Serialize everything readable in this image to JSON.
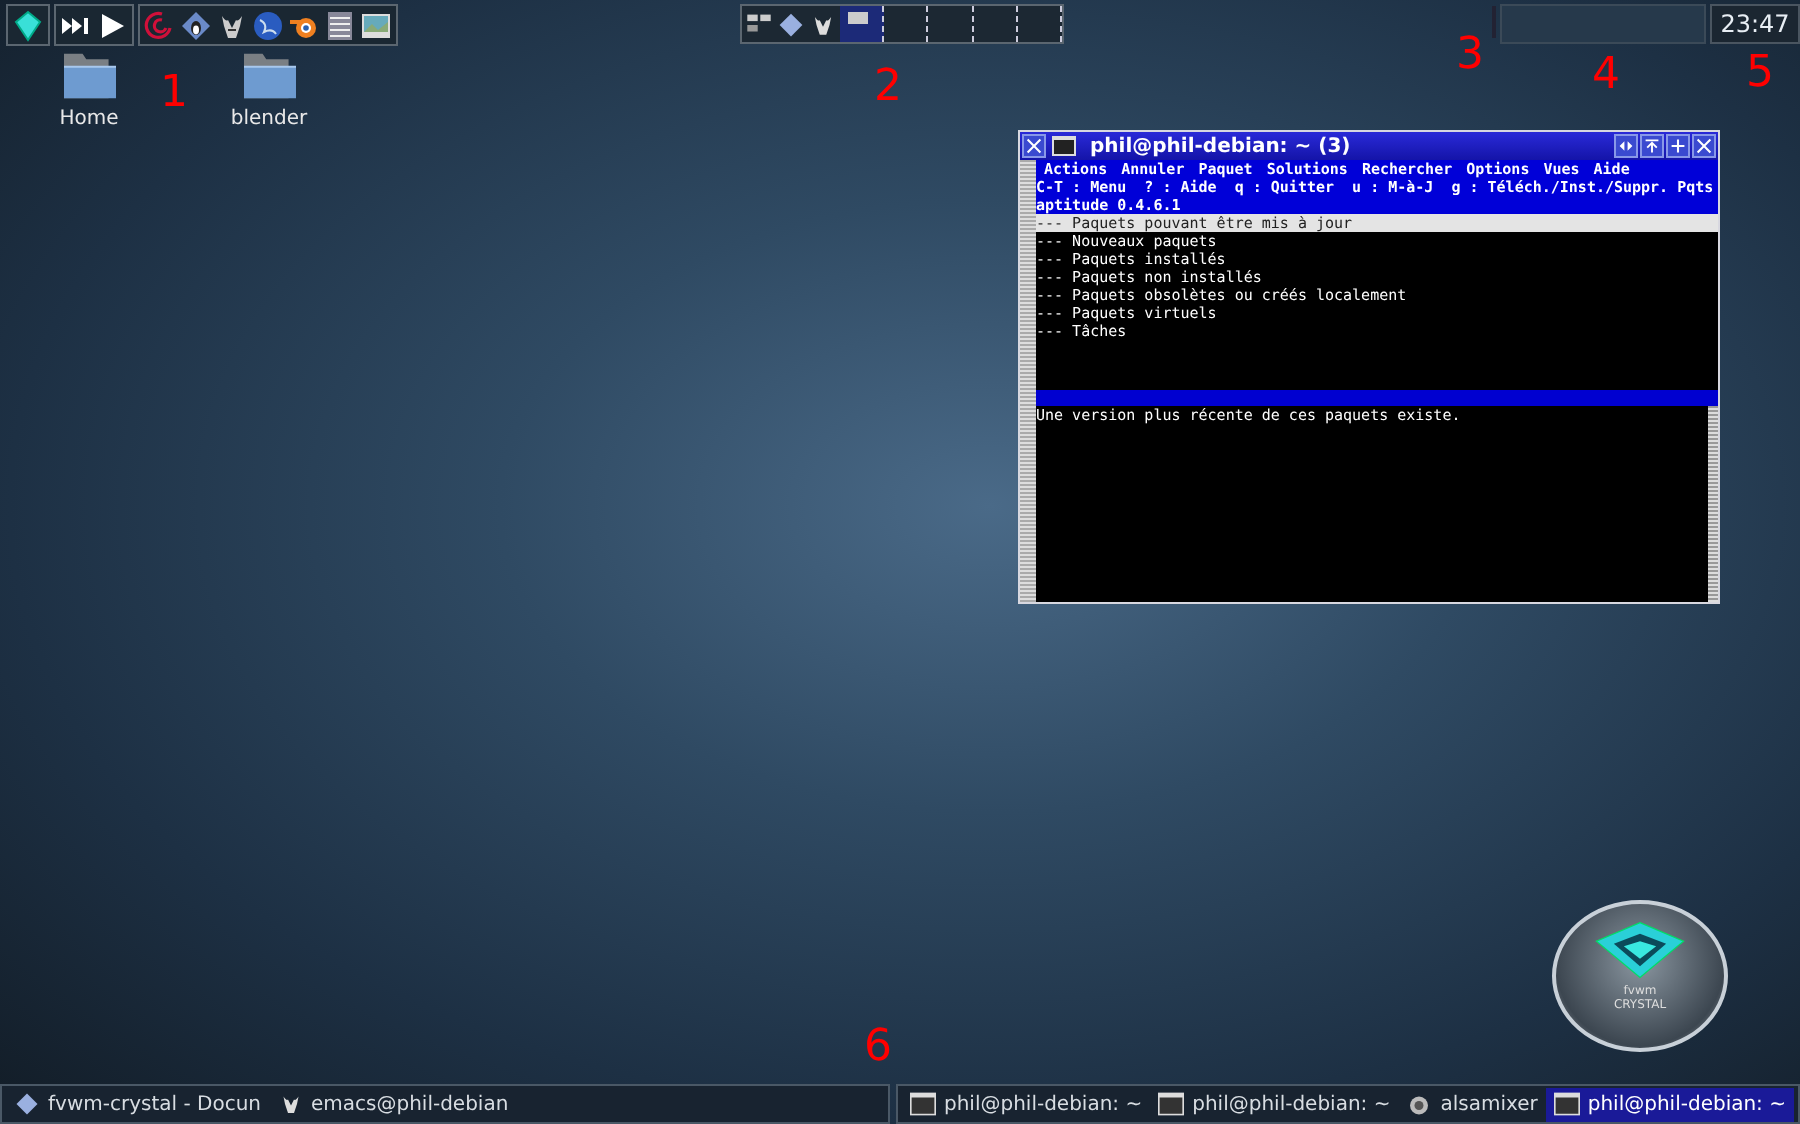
{
  "desktop_icons": [
    {
      "label": "Home"
    },
    {
      "label": "blender"
    }
  ],
  "pager": {
    "desks": [
      {
        "selected": true
      },
      {
        "selected": false
      },
      {
        "selected": false
      },
      {
        "selected": false
      },
      {
        "selected": false
      }
    ]
  },
  "clock": "23:47",
  "annotations": [
    "1",
    "2",
    "3",
    "4",
    "5",
    "6"
  ],
  "terminal": {
    "title": "phil@phil-debian: ~ (3)",
    "menu": [
      "Actions",
      "Annuler",
      "Paquet",
      "Solutions",
      "Rechercher",
      "Options",
      "Vues",
      "Aide"
    ],
    "help_line": "C-T : Menu  ? : Aide  q : Quitter  u : M-à-J  g : Téléch./Inst./Suppr. Pqts",
    "version": "aptitude 0.4.6.1",
    "items": [
      {
        "label": "--- Paquets pouvant être mis à jour",
        "selected": true
      },
      {
        "label": "--- Nouveaux paquets",
        "selected": false
      },
      {
        "label": "--- Paquets installés",
        "selected": false
      },
      {
        "label": "--- Paquets non installés",
        "selected": false
      },
      {
        "label": "--- Paquets obsolètes ou créés localement",
        "selected": false
      },
      {
        "label": "--- Paquets virtuels",
        "selected": false
      },
      {
        "label": "--- Tâches",
        "selected": false
      }
    ],
    "description": "Une version plus récente de ces paquets existe."
  },
  "logo": {
    "line_1": "fvwm",
    "line_2": "CRYSTAL"
  },
  "taskbar": {
    "left": [
      {
        "label": "fvwm-crystal - Docun",
        "kind": "diamond",
        "selected": false
      },
      {
        "label": "emacs@phil-debian",
        "kind": "gnu",
        "selected": false
      }
    ],
    "right": [
      {
        "label": "phil@phil-debian: ~",
        "kind": "terminal",
        "selected": false
      },
      {
        "label": "phil@phil-debian: ~",
        "kind": "terminal",
        "selected": false
      },
      {
        "label": "alsamixer",
        "kind": "mixer",
        "selected": false
      },
      {
        "label": "phil@phil-debian: ~",
        "kind": "terminal",
        "selected": true
      }
    ]
  }
}
